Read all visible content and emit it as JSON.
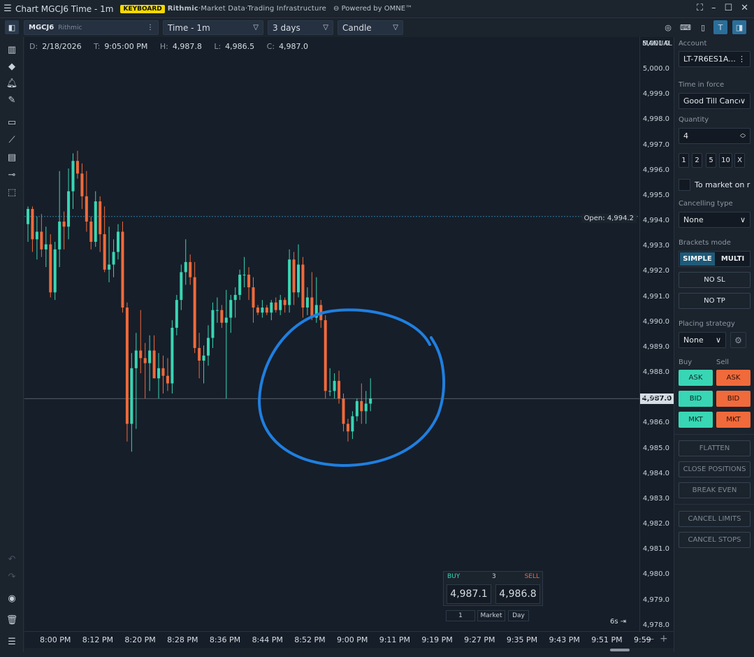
{
  "window": {
    "title": "Chart MGCJ6 Time - 1m",
    "keyboard_badge": "KEYBOARD",
    "rithmic_brand": "Rithmic",
    "rithmic_tagline": "·Market Data·Trading Infrastructure",
    "powered_by": "Powered by OMNE™"
  },
  "toolbar": {
    "symbol": "MGCJ6",
    "symbol_source": "Rithmic",
    "timeframe": "Time - 1m",
    "range": "3 days",
    "chart_style": "Candle"
  },
  "ohlc": {
    "d_label": "D:",
    "d_value": "2/18/2026",
    "t_label": "T:",
    "t_value": "9:05:00 PM",
    "h_label": "H:",
    "h_value": "4,987.8",
    "l_label": "L:",
    "l_value": "4,986.5",
    "c_label": "C:",
    "c_value": "4,987.0"
  },
  "price_axis": {
    "mode": "MANUAL",
    "labels": [
      "5,001.0",
      "5,000.0",
      "4,999.0",
      "4,998.0",
      "4,997.0",
      "4,996.0",
      "4,995.0",
      "4,994.0",
      "4,993.0",
      "4,992.0",
      "4,991.0",
      "4,990.0",
      "4,989.0",
      "4,988.0",
      "4,987.0",
      "4,986.0",
      "4,985.0",
      "4,984.0",
      "4,983.0",
      "4,982.0",
      "4,981.0",
      "4,980.0",
      "4,979.0",
      "4,978.0"
    ],
    "current_price": "4,987.0"
  },
  "open_line": {
    "label": "Open: 4,994.2",
    "value": 4994.2
  },
  "time_axis": {
    "labels": [
      "8:00 PM",
      "8:12 PM",
      "8:20 PM",
      "8:28 PM",
      "8:36 PM",
      "8:44 PM",
      "8:52 PM",
      "9:00 PM",
      "9:11 PM",
      "9:19 PM",
      "9:27 PM",
      "9:35 PM",
      "9:43 PM",
      "9:51 PM",
      "9:59"
    ]
  },
  "chart_data": {
    "type": "candlestick",
    "symbol": "MGCJ6",
    "interval": "1m",
    "ylim": [
      4977.8,
      5001.3
    ],
    "up_color": "#38d6b4",
    "down_color": "#f06a3b",
    "candles": [
      [
        4993.9,
        4994.6,
        4993.2,
        4994.5
      ],
      [
        4994.5,
        4994.6,
        4992.8,
        4993.3
      ],
      [
        4993.3,
        4994.2,
        4992.5,
        4993.6
      ],
      [
        4993.6,
        4994.3,
        4992.6,
        4992.9
      ],
      [
        4992.9,
        4993.8,
        4992.2,
        4993.1
      ],
      [
        4993.1,
        4993.5,
        4991.0,
        4991.2
      ],
      [
        4991.2,
        4993.2,
        4990.9,
        4992.9
      ],
      [
        4992.9,
        4996.0,
        4992.2,
        4994.0
      ],
      [
        4994.0,
        4994.4,
        4992.9,
        4993.8
      ],
      [
        4993.8,
        4996.1,
        4993.3,
        4995.2
      ],
      [
        4995.2,
        4996.7,
        4994.5,
        4996.4
      ],
      [
        4996.4,
        4996.8,
        4995.7,
        4995.9
      ],
      [
        4995.9,
        4996.3,
        4994.5,
        4995.0
      ],
      [
        4995.0,
        4996.0,
        4993.6,
        4994.0
      ],
      [
        4994.0,
        4994.2,
        4992.9,
        4993.2
      ],
      [
        4993.2,
        4995.2,
        4993.0,
        4994.8
      ],
      [
        4994.8,
        4995.0,
        4992.8,
        4993.5
      ],
      [
        4993.5,
        4994.6,
        4992.0,
        4992.1
      ],
      [
        4992.1,
        4993.8,
        4991.6,
        4992.3
      ],
      [
        4992.3,
        4993.3,
        4991.8,
        4992.8
      ],
      [
        4992.8,
        4993.9,
        4992.5,
        4993.6
      ],
      [
        4993.6,
        4994.0,
        4990.4,
        4990.6
      ],
      [
        4990.6,
        4990.8,
        4985.3,
        4986.0
      ],
      [
        4986.0,
        4988.8,
        4984.9,
        4988.2
      ],
      [
        4988.2,
        4989.6,
        4985.8,
        4988.9
      ],
      [
        4988.9,
        4990.5,
        4988.0,
        4988.6
      ],
      [
        4988.6,
        4989.2,
        4987.0,
        4988.4
      ],
      [
        4988.4,
        4989.5,
        4987.3,
        4988.9
      ],
      [
        4988.9,
        4989.5,
        4987.8,
        4987.8
      ],
      [
        4987.8,
        4988.8,
        4987.0,
        4988.2
      ],
      [
        4988.2,
        4988.7,
        4987.2,
        4987.9
      ],
      [
        4987.9,
        4988.6,
        4987.3,
        4987.6
      ],
      [
        4987.6,
        4990.1,
        4987.2,
        4989.8
      ],
      [
        4989.8,
        4991.1,
        4989.5,
        4990.9
      ],
      [
        4990.9,
        4992.3,
        4990.5,
        4992.0
      ],
      [
        4992.0,
        4993.3,
        4991.5,
        4992.4
      ],
      [
        4992.4,
        4992.7,
        4991.5,
        4991.8
      ],
      [
        4991.8,
        4992.4,
        4988.8,
        4989.0
      ],
      [
        4989.0,
        4989.6,
        4987.8,
        4988.5
      ],
      [
        4988.5,
        4989.1,
        4987.6,
        4988.7
      ],
      [
        4988.7,
        4989.9,
        4988.3,
        4989.4
      ],
      [
        4989.4,
        4990.8,
        4989.0,
        4990.5
      ],
      [
        4990.5,
        4991.0,
        4990.0,
        4990.5
      ],
      [
        4990.5,
        4990.7,
        4989.8,
        4990.0
      ],
      [
        4990.0,
        4991.3,
        4987.0,
        4990.2
      ],
      [
        4990.2,
        4991.1,
        4989.6,
        4990.9
      ],
      [
        4990.9,
        4991.4,
        4990.2,
        4991.1
      ],
      [
        4991.1,
        4992.1,
        4990.9,
        4991.9
      ],
      [
        4991.9,
        4992.6,
        4991.4,
        4991.9
      ],
      [
        4991.9,
        4992.2,
        4990.9,
        4991.4
      ],
      [
        4991.4,
        4991.8,
        4990.0,
        4990.6
      ],
      [
        4990.6,
        4990.7,
        4990.3,
        4990.4
      ],
      [
        4990.4,
        4990.9,
        4990.2,
        4990.6
      ],
      [
        4990.6,
        4990.7,
        4990.3,
        4990.4
      ],
      [
        4990.4,
        4990.9,
        4990.1,
        4990.8
      ],
      [
        4990.8,
        4991.0,
        4990.4,
        4990.5
      ],
      [
        4990.5,
        4991.1,
        4990.3,
        4990.9
      ],
      [
        4990.9,
        4991.0,
        4990.4,
        4990.7
      ],
      [
        4990.7,
        4992.9,
        4990.4,
        4992.5
      ],
      [
        4992.5,
        4992.8,
        4990.7,
        4991.2
      ],
      [
        4991.2,
        4993.1,
        4991.0,
        4992.3
      ],
      [
        4992.3,
        4992.6,
        4990.2,
        4990.6
      ],
      [
        4990.6,
        4991.4,
        4990.3,
        4991.0
      ],
      [
        4991.0,
        4992.0,
        4990.1,
        4990.2
      ],
      [
        4990.2,
        4991.8,
        4990.0,
        4990.7
      ],
      [
        4990.7,
        4990.9,
        4989.8,
        4990.1
      ],
      [
        4990.1,
        4990.3,
        4987.0,
        4987.3
      ],
      [
        4987.3,
        4988.2,
        4987.1,
        4987.3
      ],
      [
        4987.3,
        4988.0,
        4987.0,
        4987.7
      ],
      [
        4987.7,
        4988.1,
        4986.8,
        4987.0
      ],
      [
        4987.0,
        4987.2,
        4985.7,
        4986.0
      ],
      [
        4986.0,
        4986.2,
        4985.3,
        4985.7
      ],
      [
        4985.7,
        4986.5,
        4985.4,
        4986.3
      ],
      [
        4986.3,
        4987.0,
        4986.1,
        4986.9
      ],
      [
        4986.9,
        4987.6,
        4986.0,
        4986.5
      ],
      [
        4986.5,
        4987.3,
        4986.0,
        4986.8
      ],
      [
        4986.8,
        4987.8,
        4986.5,
        4987.0
      ]
    ]
  },
  "order_panel": {
    "account_label": "Account",
    "account_value": "LT-7R6ES1A...",
    "tif_label": "Time in force",
    "tif_value": "Good Till Cancel",
    "qty_label": "Quantity",
    "qty_value": "4",
    "qty_presets": [
      "1",
      "2",
      "5",
      "10",
      "X"
    ],
    "to_market_label": "To market on r",
    "cancel_type_label": "Cancelling type",
    "cancel_type_value": "None",
    "brackets_label": "Brackets mode",
    "brackets_simple": "SIMPLE",
    "brackets_multi": "MULTI",
    "no_sl": "NO SL",
    "no_tp": "NO TP",
    "placing_label": "Placing strategy",
    "placing_value": "None",
    "buy_label": "Buy",
    "sell_label": "Sell",
    "ask": "ASK",
    "bid": "BID",
    "mkt": "MKT",
    "flatten": "FLATTEN",
    "close_positions": "CLOSE POSITIONS",
    "break_even": "BREAK EVEN",
    "cancel_limits": "CANCEL LIMITS",
    "cancel_stops": "CANCEL STOPS"
  },
  "quick_trade": {
    "buy_label": "BUY",
    "qty": "3",
    "sell_label": "SELL",
    "buy_price": "4,987.1",
    "sell_price": "4,986.8",
    "qty_input": "1",
    "order_type": "Market",
    "tif": "Day"
  },
  "chart_footer": {
    "timer": "6s"
  },
  "annotation": {
    "color": "#1f7fe0"
  }
}
